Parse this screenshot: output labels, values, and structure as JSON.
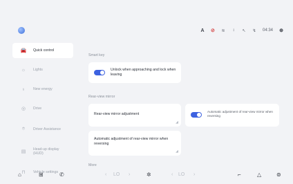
{
  "status_bar": {
    "items": [
      "A",
      "⊘",
      "≋",
      "↕",
      "↖",
      "↯",
      "04:34",
      "⊕"
    ]
  },
  "sidebar": {
    "items": [
      {
        "label": "Quick control",
        "icon": "car-icon",
        "glyph": "🚘",
        "active": true
      },
      {
        "label": "Lights",
        "icon": "light-icon",
        "glyph": "☼",
        "active": false
      },
      {
        "label": "New energy",
        "icon": "energy-icon",
        "glyph": "♁",
        "active": false
      },
      {
        "label": "Drive",
        "icon": "steering-wheel-icon",
        "glyph": "◎",
        "active": false
      },
      {
        "label": "Driver Assistance",
        "icon": "assistance-icon",
        "glyph": "⌾",
        "active": false
      },
      {
        "label": "Head-up display (HUD)",
        "icon": "hud-icon",
        "glyph": "▤",
        "active": false
      },
      {
        "label": "Vehicle settings",
        "icon": "vehicle-icon",
        "glyph": "⊓",
        "active": false
      }
    ]
  },
  "main": {
    "smart_key": {
      "title": "Smart key",
      "option_label": "Unlock when approaching and lock when leaving",
      "enabled": true
    },
    "rear_view_mirror": {
      "title": "Rear-view mirror",
      "adjustment_label": "Rear-view mirror adjustment",
      "auto_label": "Automatic adjustment of rear-view mirror when reversing"
    },
    "popup": {
      "label": "Automatic adjustment of rear-view mirror when reversing",
      "enabled": true
    },
    "more": {
      "title": "More"
    }
  },
  "dock": {
    "home": "⌂",
    "apps": "⊞",
    "phone": "✆",
    "temp_left": "LO",
    "fan": "✲",
    "temp_right": "LO",
    "seat": "⌐",
    "warning": "△",
    "power": "⊚",
    "left_arrow_l": "‹",
    "left_arrow_r": "›",
    "right_arrow_l": "‹",
    "right_arrow_r": "›"
  }
}
